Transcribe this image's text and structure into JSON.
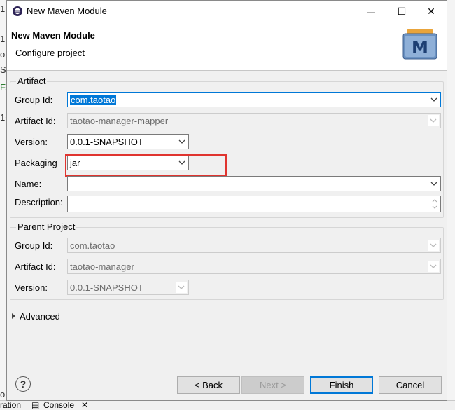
{
  "background": {
    "left_fragments": [
      "1",
      "1C",
      "ot",
      "S",
      "F.A",
      "1C",
      "or"
    ],
    "bottom_tab1": "ration",
    "bottom_tab2": "Console",
    "bottom_close": "✕"
  },
  "window": {
    "title": "New Maven Module",
    "minimize_glyph": "—",
    "maximize_glyph": "☐",
    "close_glyph": "✕"
  },
  "banner": {
    "title": "New Maven Module",
    "subtitle": "Configure project",
    "logo_letter": "M"
  },
  "artifact": {
    "group_label": "Artifact",
    "group_id_label": "Group Id:",
    "group_id_value": "com.taotao",
    "artifact_id_label": "Artifact Id:",
    "artifact_id_value": "taotao-manager-mapper",
    "version_label": "Version:",
    "version_value": "0.0.1-SNAPSHOT",
    "packaging_label": "Packaging",
    "packaging_value": "jar",
    "name_label": "Name:",
    "name_value": "",
    "description_label": "Description:",
    "description_value": ""
  },
  "parent": {
    "group_label": "Parent Project",
    "group_id_label": "Group Id:",
    "group_id_value": "com.taotao",
    "artifact_id_label": "Artifact Id:",
    "artifact_id_value": "taotao-manager",
    "version_label": "Version:",
    "version_value": "0.0.1-SNAPSHOT"
  },
  "advanced": {
    "label": "Advanced"
  },
  "buttons": {
    "help": "?",
    "back": "< Back",
    "next": "Next >",
    "finish": "Finish",
    "cancel": "Cancel"
  },
  "colors": {
    "focus": "#0078d7",
    "highlight": "#e0342f",
    "dialog_bg": "#f0f0f0"
  }
}
